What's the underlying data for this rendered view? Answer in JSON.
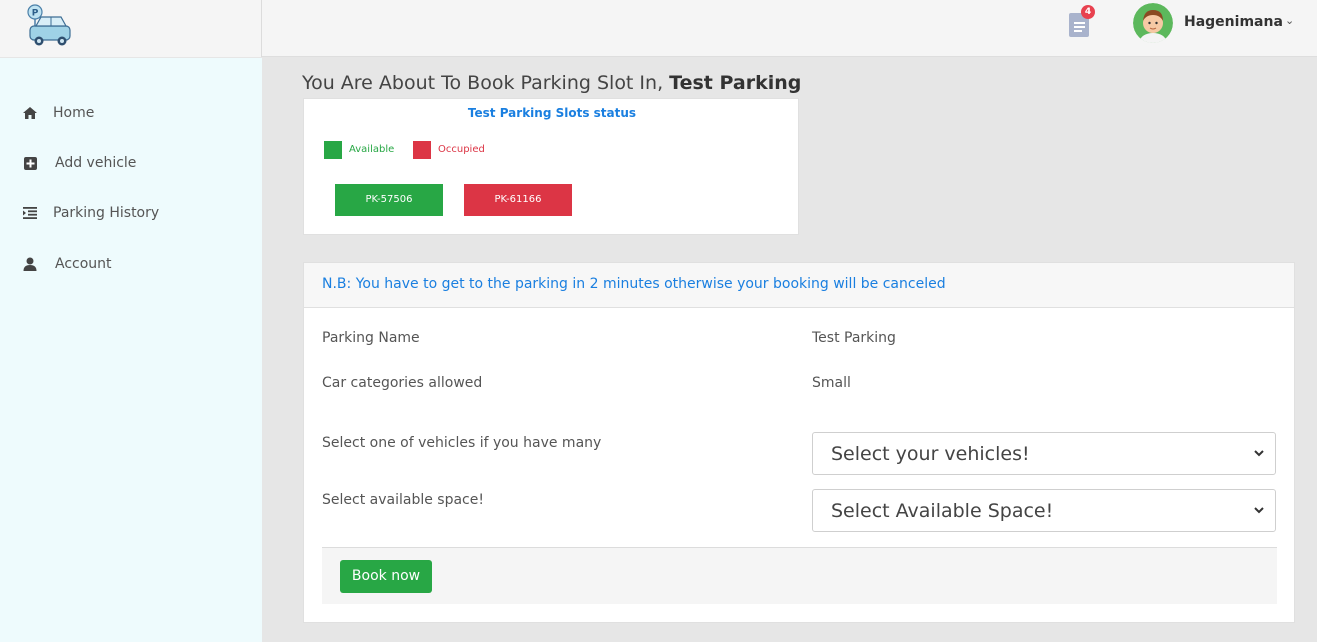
{
  "header": {
    "notification_count": "4",
    "username": "Hagenimana",
    "caret": "⌄"
  },
  "sidebar": {
    "items": [
      {
        "label": "Home",
        "icon": "home-icon"
      },
      {
        "label": "Add vehicle",
        "icon": "plus-square-icon"
      },
      {
        "label": "Parking History",
        "icon": "list-icon"
      },
      {
        "label": "Account",
        "icon": "user-icon"
      }
    ]
  },
  "page": {
    "title_prefix": "You Are About To Book Parking Slot In, ",
    "title_parking": "Test Parking"
  },
  "slots_status": {
    "title": "Test Parking Slots status",
    "legend_available": "Available",
    "legend_occupied": "Occupied",
    "colors": {
      "available": "#28a745",
      "occupied": "#dc3545"
    },
    "slots": [
      {
        "code": "PK-57506",
        "status": "available"
      },
      {
        "code": "PK-61166",
        "status": "occupied"
      }
    ]
  },
  "booking": {
    "notice": "N.B: You have to get to the parking in 2 minutes otherwise your booking will be canceled",
    "parking_name_label": "Parking Name",
    "parking_name_value": "Test Parking",
    "car_categories_label": "Car categories allowed",
    "car_categories_value": "Small",
    "vehicle_label": "Select one of vehicles if you have many",
    "vehicle_select_value": "Select your vehicles!",
    "space_label": "Select available space!",
    "space_select_value": "Select Available Space!",
    "book_button": "Book now"
  }
}
